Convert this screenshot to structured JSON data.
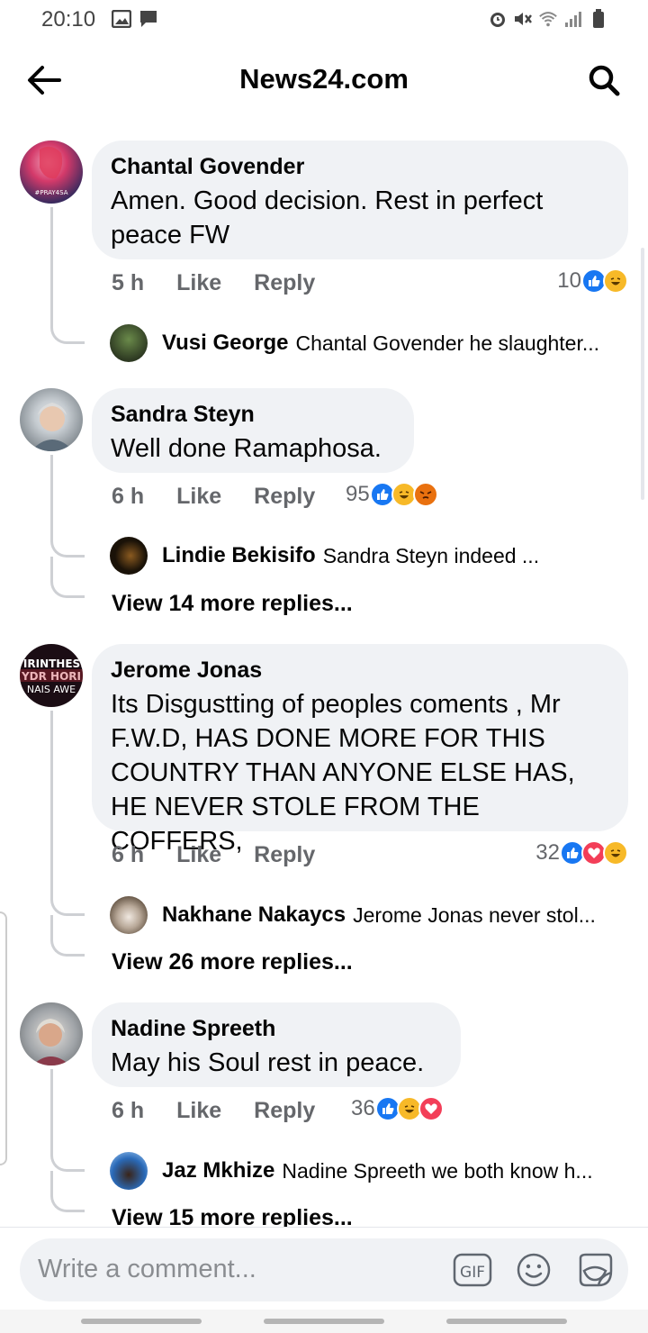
{
  "status_bar": {
    "time": "20:10",
    "left_icons": [
      "image-icon",
      "message-icon"
    ],
    "right_icons": [
      "alarm-icon",
      "mute-icon",
      "wifi-icon",
      "signal-icon",
      "battery-icon"
    ]
  },
  "header": {
    "title": "News24.com",
    "back_icon": "back-arrow-icon",
    "search_icon": "search-icon"
  },
  "comments": [
    {
      "author": "Chantal Govender",
      "text": "Amen. Good decision. Rest in perfect peace FW",
      "time": "5 h",
      "like_label": "Like",
      "reply_label": "Reply",
      "reaction_count": "10",
      "reactions": [
        "like",
        "haha"
      ],
      "avatar_overlay": "#PRAY4SA",
      "avatar_colors": [
        "#3a2a5e",
        "#d43a6a",
        "#f2a0b8"
      ],
      "reply_preview": {
        "author": "Vusi George",
        "text": "Chantal Govender he slaughter..."
      }
    },
    {
      "author": "Sandra Steyn",
      "text": "Well done Ramaphosa.",
      "time": "6 h",
      "like_label": "Like",
      "reply_label": "Reply",
      "reaction_count": "95",
      "reactions": [
        "like",
        "haha",
        "angry"
      ],
      "avatar_colors": [
        "#9aa3a8",
        "#e9ecef",
        "#7a8288"
      ],
      "reply_preview": {
        "author": "Lindie Bekisifo",
        "text": "Sandra Steyn indeed ..."
      },
      "view_more": "View 14 more replies..."
    },
    {
      "author": "Jerome Jonas",
      "text": "Its Disgustting of peoples coments , Mr F.W.D, HAS DONE MORE FOR THIS COUNTRY THAN ANYONE ELSE HAS, HE NEVER STOLE FROM THE COFFERS,",
      "time": "6 h",
      "like_label": "Like",
      "reply_label": "Reply",
      "reaction_count": "32",
      "reactions": [
        "like",
        "love",
        "haha"
      ],
      "avatar_overlay_lines": [
        "VIRINTHESE",
        "YDR HORI",
        "NAIS AWE"
      ],
      "avatar_colors": [
        "#1b0d14",
        "#c82a3a",
        "#ffffff"
      ],
      "reply_preview": {
        "author": "Nakhane Nakaycs",
        "text": "Jerome Jonas never stol..."
      },
      "view_more": "View 26 more replies..."
    },
    {
      "author": "Nadine Spreeth",
      "text": "May his Soul rest in peace.",
      "time": "6 h",
      "like_label": "Like",
      "reply_label": "Reply",
      "reaction_count": "36",
      "reactions": [
        "like",
        "haha",
        "love"
      ],
      "avatar_colors": [
        "#6b6f72",
        "#d9a78a",
        "#e7e3de"
      ],
      "reply_preview": {
        "author": "Jaz Mkhize",
        "text": "Nadine Spreeth we both know h..."
      },
      "view_more": "View 15 more replies..."
    }
  ],
  "composer": {
    "placeholder": "Write a comment...",
    "tools": [
      "gif-icon",
      "emoji-icon",
      "sticker-icon"
    ],
    "gif_label": "GIF"
  },
  "colors": {
    "bubble": "#f0f2f5",
    "like_blue": "#1877f2",
    "haha_yellow": "#f7b928",
    "love_red": "#f33e58",
    "angry_orange": "#e9710f",
    "meta_gray": "#65676b"
  }
}
